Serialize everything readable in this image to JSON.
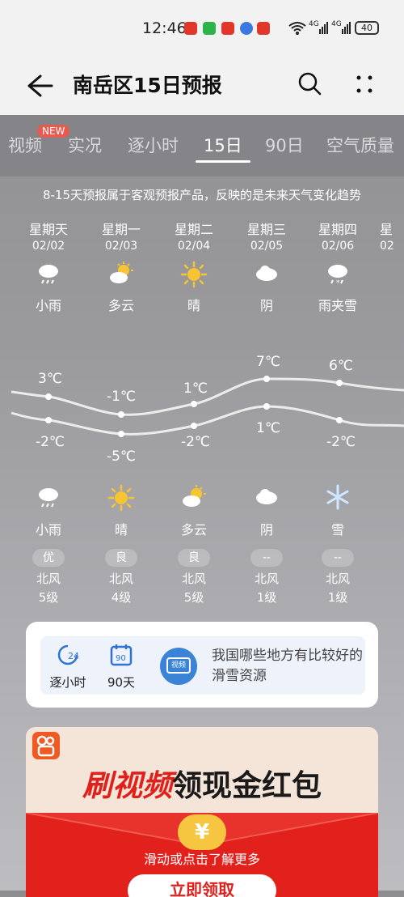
{
  "status": {
    "time": "12:46",
    "battery": "40",
    "signal_label_1": "4G",
    "signal_label_2": "4G",
    "wifi_num": "6"
  },
  "header": {
    "title": "南岳区15日预报"
  },
  "tabs": [
    {
      "label": "视频"
    },
    {
      "label": "实况"
    },
    {
      "label": "逐小时"
    },
    {
      "label": "15日",
      "active": true
    },
    {
      "label": "90日"
    },
    {
      "label": "空气质量"
    }
  ],
  "new_badge": "NEW",
  "notice": "8-15天预报属于客观预报产品，反映的是未来天气变化趋势",
  "days": [
    {
      "weekday": "星期天",
      "date": "02/02",
      "day_icon": "light-rain-icon",
      "day_cond": "小雨",
      "high": "3℃",
      "low": "-2℃",
      "night_icon": "light-rain-icon",
      "night_cond": "小雨",
      "aqi": "优",
      "wind_dir": "北风",
      "wind_level": "5级"
    },
    {
      "weekday": "星期一",
      "date": "02/03",
      "day_icon": "partly-cloudy-icon",
      "day_cond": "多云",
      "high": "-1℃",
      "low": "-5℃",
      "night_icon": "sunny-icon",
      "night_cond": "晴",
      "aqi": "良",
      "wind_dir": "北风",
      "wind_level": "4级"
    },
    {
      "weekday": "星期二",
      "date": "02/04",
      "day_icon": "sunny-icon",
      "day_cond": "晴",
      "high": "1℃",
      "low": "-2℃",
      "night_icon": "partly-cloudy-icon",
      "night_cond": "多云",
      "aqi": "良",
      "wind_dir": "北风",
      "wind_level": "5级"
    },
    {
      "weekday": "星期三",
      "date": "02/05",
      "day_icon": "overcast-icon",
      "day_cond": "阴",
      "high": "7℃",
      "low": "1℃",
      "night_icon": "overcast-icon",
      "night_cond": "阴",
      "aqi": "--",
      "wind_dir": "北风",
      "wind_level": "1级"
    },
    {
      "weekday": "星期四",
      "date": "02/06",
      "day_icon": "sleet-icon",
      "day_cond": "雨夹雪",
      "high": "6℃",
      "low": "-2℃",
      "night_icon": "snow-icon",
      "night_cond": "雪",
      "aqi": "--",
      "wind_dir": "北风",
      "wind_level": "1级"
    }
  ],
  "quick": {
    "hourly": "逐小时",
    "hourly_num": "24",
    "ninety": "90天",
    "ninety_num": "90",
    "video_icon_text": "视频",
    "article": "我国哪些地方有比较好的滑雪资源"
  },
  "ad": {
    "title_red": "刷视频",
    "title_black": "领现金红包",
    "hint": "滑动或点击了解更多",
    "button": "立即领取",
    "coin": "¥"
  }
}
